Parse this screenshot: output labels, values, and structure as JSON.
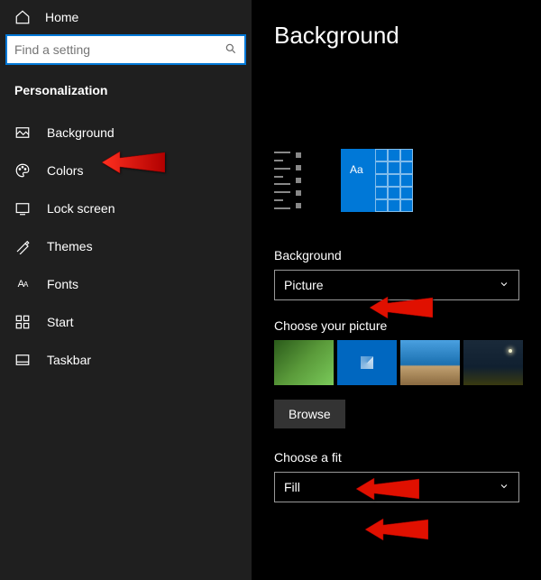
{
  "sidebar": {
    "home_label": "Home",
    "search_placeholder": "Find a setting",
    "section_label": "Personalization",
    "items": [
      {
        "label": "Background"
      },
      {
        "label": "Colors"
      },
      {
        "label": "Lock screen"
      },
      {
        "label": "Themes"
      },
      {
        "label": "Fonts"
      },
      {
        "label": "Start"
      },
      {
        "label": "Taskbar"
      }
    ]
  },
  "main": {
    "title": "Background",
    "background_label": "Background",
    "background_value": "Picture",
    "choose_picture_label": "Choose your picture",
    "browse_label": "Browse",
    "choose_fit_label": "Choose a fit",
    "choose_fit_value": "Fill",
    "preview_text": "Aa"
  }
}
